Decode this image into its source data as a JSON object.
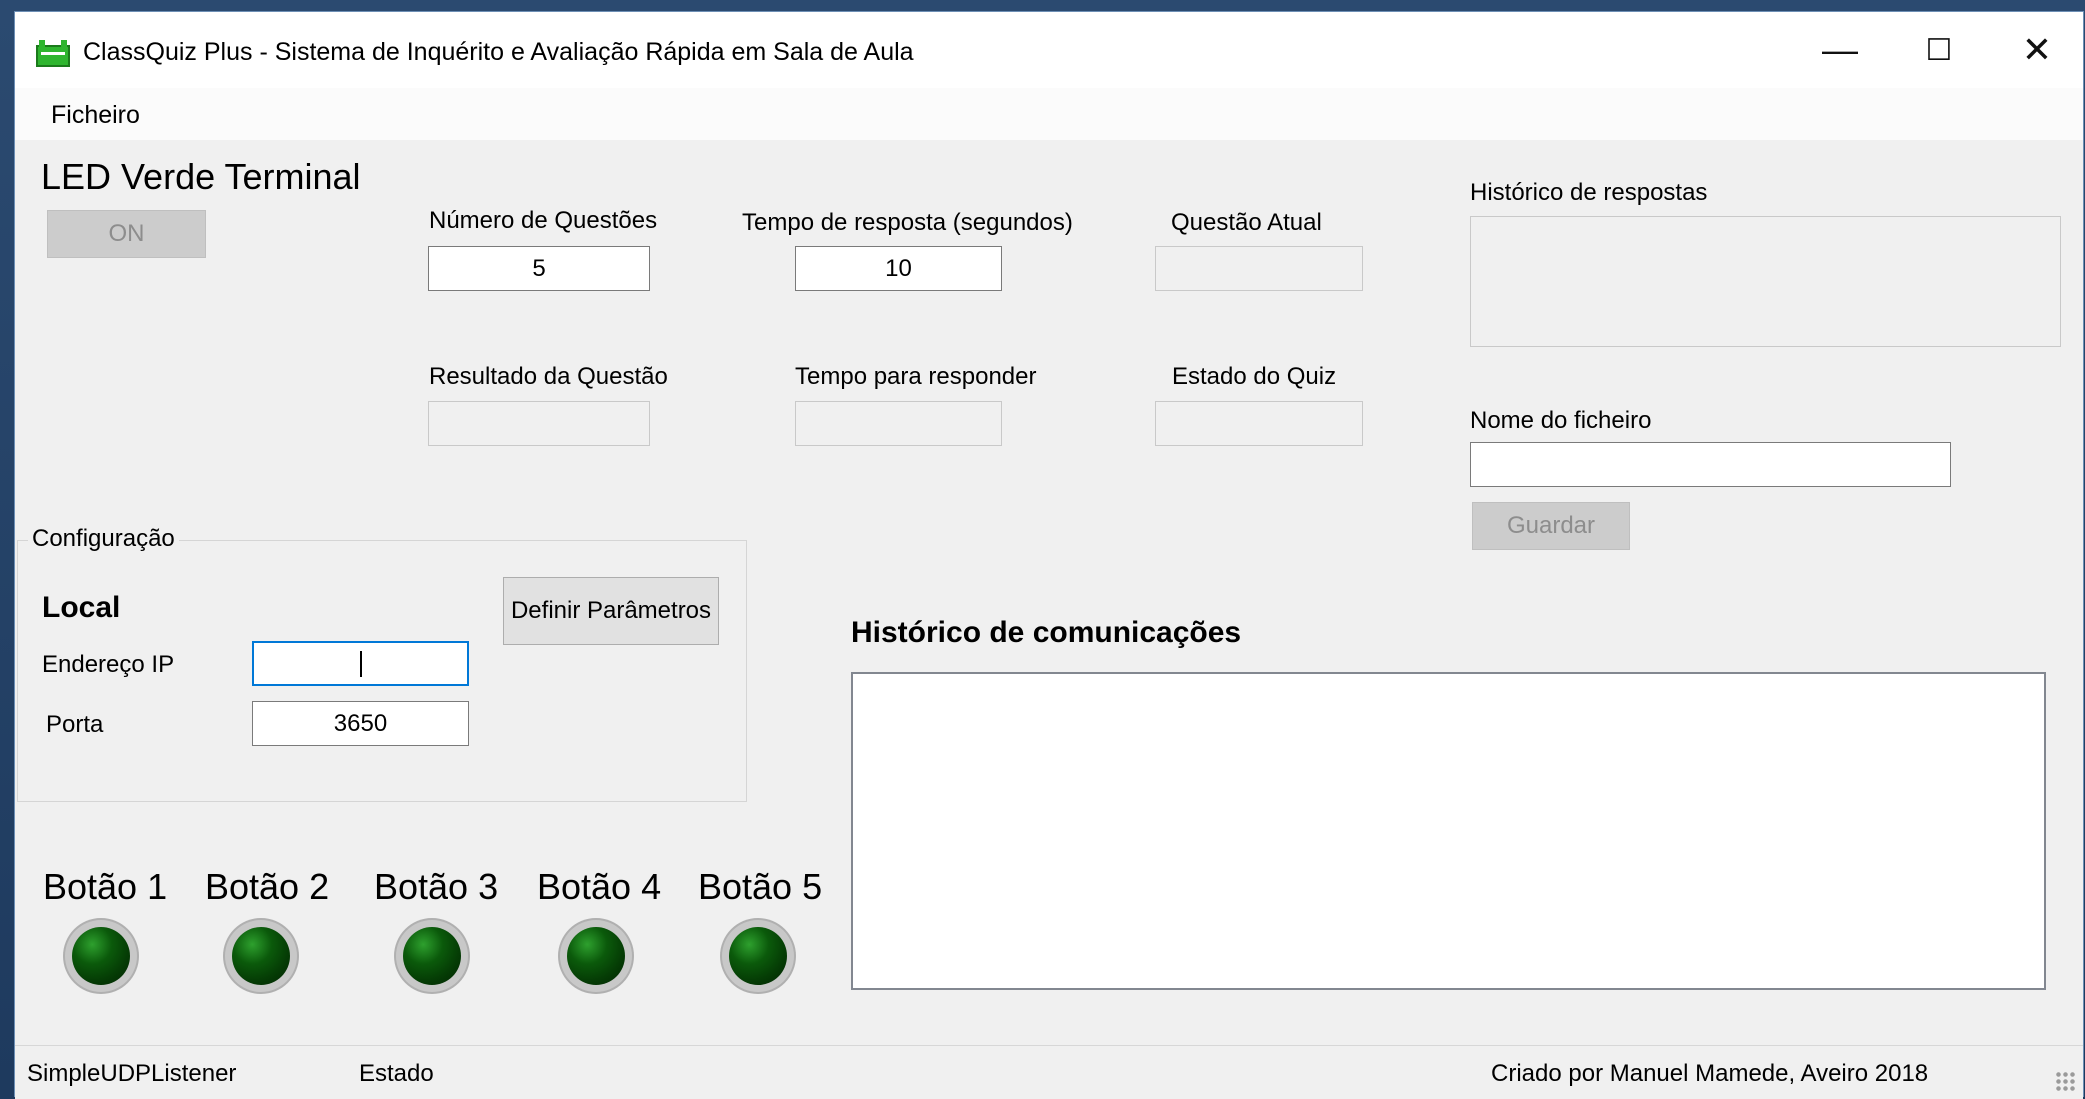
{
  "window": {
    "title": "ClassQuiz Plus - Sistema de Inquérito e Avaliação Rápida em Sala de Aula",
    "minimize": "—",
    "maximize": "☐",
    "close": "✕"
  },
  "menu": {
    "items": [
      "Ficheiro"
    ]
  },
  "led_terminal": {
    "label": "LED Verde Terminal",
    "button": "ON"
  },
  "fields": {
    "num_questions": {
      "label": "Número de Questões",
      "value": "5"
    },
    "response_time": {
      "label": "Tempo de resposta (segundos)",
      "value": "10"
    },
    "current_question": {
      "label": "Questão Atual",
      "value": ""
    },
    "question_result": {
      "label": "Resultado da Questão",
      "value": ""
    },
    "time_to_answer": {
      "label": "Tempo para responder",
      "value": ""
    },
    "quiz_state": {
      "label": "Estado do Quiz",
      "value": ""
    }
  },
  "answers_history": {
    "label": "Histórico de respostas"
  },
  "file": {
    "label": "Nome do ficheiro",
    "value": "",
    "save_button": "Guardar"
  },
  "config": {
    "title": "Configuração",
    "local_label": "Local",
    "ip_label": "Endereço IP",
    "ip_value": "",
    "port_label": "Porta",
    "port_value": "3650",
    "set_params_button": "Definir Parâmetros"
  },
  "comm_history": {
    "label": "Histórico de comunicações"
  },
  "buttons": [
    {
      "label": "Botão 1"
    },
    {
      "label": "Botão 2"
    },
    {
      "label": "Botão 3"
    },
    {
      "label": "Botão 4"
    },
    {
      "label": "Botão 5"
    }
  ],
  "status": {
    "listener": "SimpleUDPListener",
    "state": "Estado",
    "credits": "Criado por Manuel Mamede, Aveiro 2018"
  },
  "colors": {
    "led_green": "#0b5a0b",
    "app_icon": "#2fb52f",
    "focus_border": "#0078d7"
  }
}
